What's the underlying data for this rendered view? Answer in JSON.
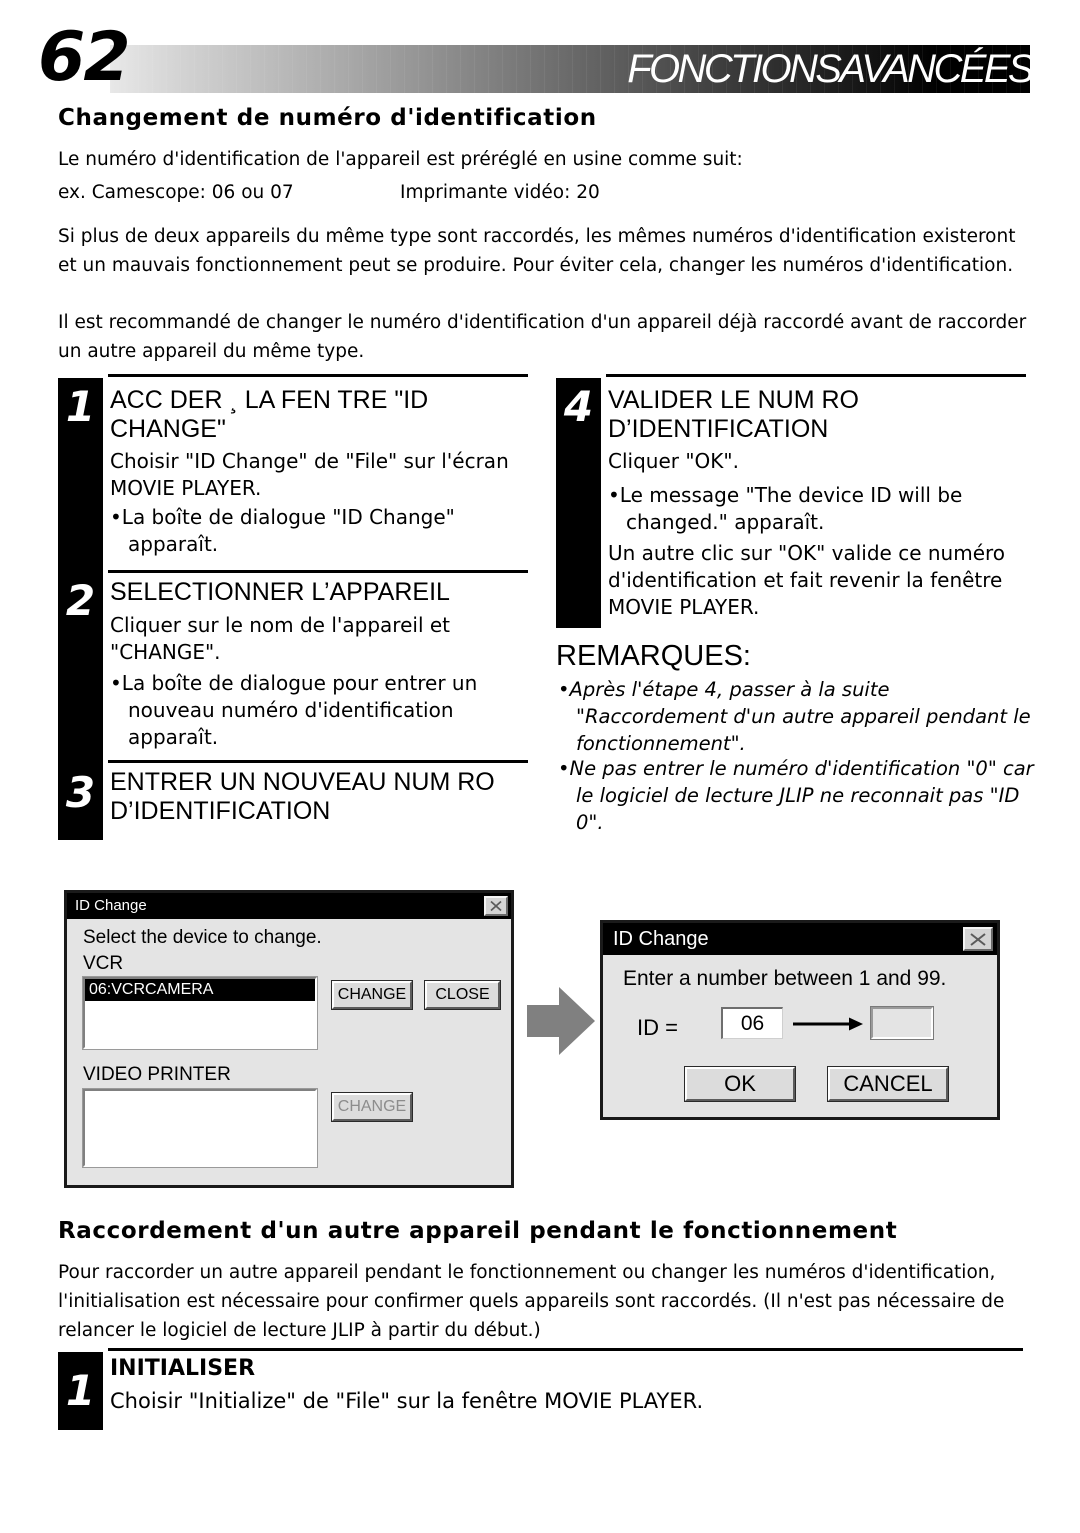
{
  "header": {
    "page_number": "62",
    "title": "FONCTIONSAVANCÉES"
  },
  "section1": {
    "heading": "Changement de numéro d'identification",
    "intro": "Le numéro d'identification de l'appareil est préréglé en usine comme suit:",
    "example_left": "ex. Camescope: 06 ou 07",
    "example_right": "Imprimante vidéo: 20",
    "para2": "Si plus de deux appareils du même type sont raccordés, les mêmes numéros d'identification existeront et un mauvais fonctionnement peut se produire. Pour éviter cela, changer les numéros d'identification.",
    "para3": "Il est recommandé de changer le numéro d'identification d'un appareil déjà raccordé avant de raccorder un autre appareil du même type."
  },
  "steps_left": [
    {
      "number": "1",
      "title": "ACC DER ¸ LA FEN TRE \"ID CHANGE\"",
      "text": "Choisir \"ID Change\" de \"File\" sur l'écran MOVIE PLAYER.",
      "bullet": "•La boîte de dialogue \"ID Change\" apparaît."
    },
    {
      "number": "2",
      "title": "SELECTIONNER L’APPAREIL",
      "text": "Cliquer sur le nom de l'appareil et \"CHANGE\".",
      "bullet": "•La boîte de dialogue pour entrer un nouveau numéro d'identification apparaît."
    },
    {
      "number": "3",
      "title": "ENTRER UN NOUVEAU NUM RO D’IDENTIFICATION",
      "text": "",
      "bullet": ""
    }
  ],
  "steps_right": [
    {
      "number": "4",
      "title": "VALIDER LE NUM RO D’IDENTIFICATION",
      "text": "Cliquer \"OK\".",
      "bullet": "•Le message \"The device ID will be changed.\" apparaît.",
      "text2": "Un autre clic sur \"OK\" valide ce numéro d'identification et fait revenir la fenêtre MOVIE PLAYER."
    }
  ],
  "remarques": {
    "title": "REMARQUES:",
    "items": [
      "•Après l'étape 4, passer à la suite \"Raccordement d'un autre appareil pendant le fonctionnement\".",
      "•Ne pas entrer le numéro d'identification \"0\" car le logiciel de lecture JLIP ne reconnait pas \"ID 0\"."
    ]
  },
  "dialog_select": {
    "title": "ID Change",
    "close_icon": "close-x-icon",
    "prompt": "Select the device to change.",
    "vcr_label": "VCR",
    "vcr_selected_item": "06:VCRCAMERA",
    "printer_label": "VIDEO PRINTER",
    "change_button": "CHANGE",
    "close_button": "CLOSE",
    "printer_change_button": "CHANGE"
  },
  "flow_arrow": {
    "icon": "right-block-arrow-icon",
    "color": "#808080"
  },
  "dialog_enter": {
    "title": "ID Change",
    "close_icon": "close-x-icon",
    "prompt": "Enter a number between 1 and 99.",
    "id_label": "ID  =",
    "current_value": "06",
    "new_value": "",
    "transition_icon": "right-arrow-icon",
    "ok_button": "OK",
    "cancel_button": "CANCEL"
  },
  "section2": {
    "heading": "Raccordement d'un autre appareil pendant le fonctionnement",
    "para": "Pour raccorder un autre appareil pendant le fonctionnement ou changer les numéros d'identification, l'initialisation est nécessaire pour confirmer quels appareils sont raccordés. (Il n'est pas nécessaire de relancer le logiciel de lecture JLIP à partir du début.)",
    "step": {
      "number": "1",
      "title": "INITIALISER",
      "text": "Choisir \"Initialize\" de \"File\" sur la fenêtre MOVIE PLAYER."
    }
  }
}
